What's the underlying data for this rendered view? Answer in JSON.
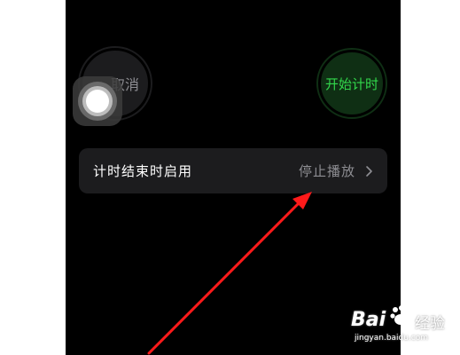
{
  "timer": {
    "cancel_label": "取消",
    "start_label": "开始计时"
  },
  "settings_row": {
    "label": "计时结束时启用",
    "value": "停止播放"
  },
  "watermark": {
    "logo": "Bai",
    "brand": "经验",
    "url": "jingyan.baidu.com"
  },
  "icons": {
    "chevron": "chevron-right-icon",
    "assistive": "assistive-touch-icon",
    "paw": "baidu-paw-icon"
  },
  "colors": {
    "background": "#000000",
    "row_background": "#1c1c1e",
    "start_text": "#32d74b",
    "start_background": "#0f2f14",
    "arrow": "#ff1a1a"
  }
}
